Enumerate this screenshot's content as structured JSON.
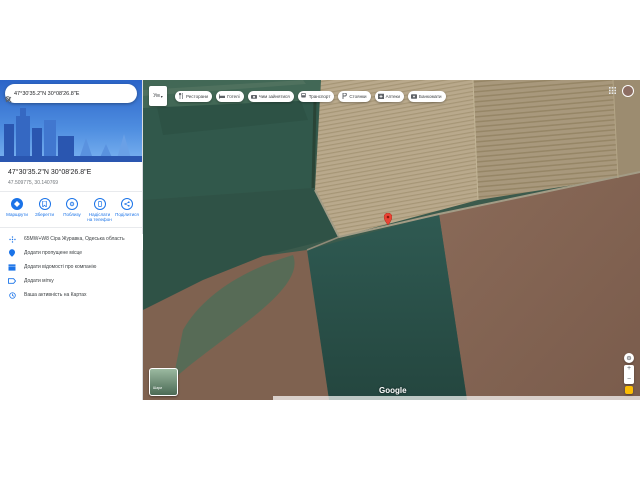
{
  "search": {
    "value": "47°30'35.2\"N 30°08'26.8\"E"
  },
  "place": {
    "title": "47°30'35.2\"N 30°08'26.8\"E",
    "coords": "47.509775, 30.140769"
  },
  "actions": [
    {
      "label": "Маршрути",
      "icon": "directions-icon"
    },
    {
      "label": "Зберегти",
      "icon": "bookmark-icon"
    },
    {
      "label": "Поблизу",
      "icon": "nearby-icon"
    },
    {
      "label": "Надіслати на телефон",
      "icon": "phone-icon"
    },
    {
      "label": "Поділитися",
      "icon": "share-icon"
    }
  ],
  "details": [
    {
      "text": "65MW+W8 Сіра Журавка, Одеська область",
      "icon": "plus-code-icon"
    },
    {
      "text": "Додати пропущене місце",
      "icon": "add-place-icon"
    },
    {
      "text": "Додати відомості про компанію",
      "icon": "business-icon"
    },
    {
      "text": "Додати мітку",
      "icon": "label-icon"
    },
    {
      "text": "Ваша активність на Картах",
      "icon": "history-icon"
    }
  ],
  "map": {
    "layer_button": "Ум",
    "chips": [
      {
        "label": "Ресторани",
        "icon": "restaurant-icon"
      },
      {
        "label": "Готелі",
        "icon": "hotel-icon"
      },
      {
        "label": "Чим зайнятися",
        "icon": "camera-icon"
      },
      {
        "label": "Транспорт",
        "icon": "transit-icon"
      },
      {
        "label": "Стоянки",
        "icon": "parking-icon"
      },
      {
        "label": "Аптеки",
        "icon": "pharmacy-icon"
      },
      {
        "label": "Банкомати",
        "icon": "atm-icon"
      }
    ],
    "logo": "Google",
    "layers_label": "Шари",
    "colors": {
      "accent": "#1a73e8",
      "pin": "#ea4335"
    }
  }
}
